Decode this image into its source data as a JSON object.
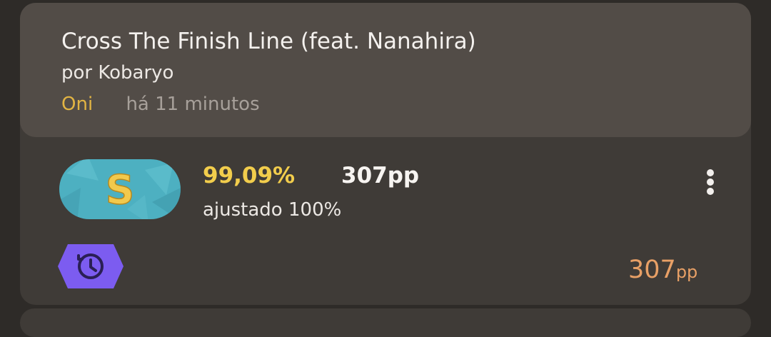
{
  "score": {
    "title": "Cross The Finish Line (feat. Nanahira)",
    "artist": "por Kobaryo",
    "difficulty": "Oni",
    "time_ago": "há 11 minutos",
    "rank": "S",
    "accuracy": "99,09%",
    "pp": "307pp",
    "adjusted": "ajustado 100%",
    "total_pp_number": "307",
    "total_pp_unit": "pp"
  },
  "icons": {
    "more": "more-vertical-icon",
    "replay": "history-icon"
  },
  "colors": {
    "accent_gold": "#e2b443",
    "accuracy": "#f2cd4c",
    "pp_orange": "#e8a066",
    "rank_badge": "#4fb3c3",
    "replay_badge": "#7c5cf0"
  }
}
